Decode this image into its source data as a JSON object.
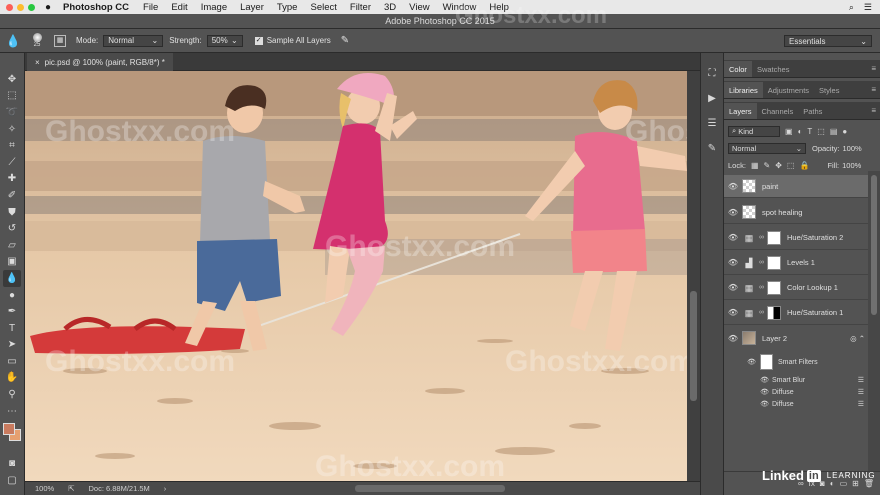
{
  "menubar": {
    "app_name": "Photoshop CC",
    "items": [
      "File",
      "Edit",
      "Image",
      "Layer",
      "Type",
      "Select",
      "Filter",
      "3D",
      "View",
      "Window",
      "Help"
    ]
  },
  "titlebar": {
    "title": "Adobe Photoshop CC 2015"
  },
  "options": {
    "brush_size": "25",
    "mode_label": "Mode:",
    "mode_value": "Normal",
    "strength_label": "Strength:",
    "strength_value": "50%",
    "sample_all_label": "Sample All Layers",
    "workspace": "Essentials"
  },
  "document": {
    "tab_title": "pic.psd @ 100% (paint, RGB/8*) *"
  },
  "status": {
    "zoom": "100%",
    "doc_size": "Doc: 6.88M/21.5M"
  },
  "panels": {
    "color_tabs": [
      "Color",
      "Swatches"
    ],
    "library_tabs": [
      "Libraries",
      "Adjustments",
      "Styles"
    ],
    "layer_tabs": [
      "Layers",
      "Channels",
      "Paths"
    ],
    "filter_kind": "Kind",
    "blend_mode": "Normal",
    "opacity_label": "Opacity:",
    "opacity_value": "100%",
    "lock_label": "Lock:",
    "fill_label": "Fill:",
    "fill_value": "100%"
  },
  "layers": [
    {
      "name": "paint"
    },
    {
      "name": "spot healing"
    },
    {
      "name": "Hue/Saturation 2"
    },
    {
      "name": "Levels 1"
    },
    {
      "name": "Color Lookup 1"
    },
    {
      "name": "Hue/Saturation 1"
    },
    {
      "name": "Layer 2"
    }
  ],
  "smart_filters": {
    "label": "Smart Filters",
    "items": [
      "Smart Blur",
      "Diffuse",
      "Diffuse"
    ]
  },
  "watermark": {
    "text": "Ghostxx.com"
  },
  "branding": {
    "linked": "Linked",
    "in": "in",
    "learning": "LEARNING"
  },
  "colors": {
    "foreground": "#c97b5f",
    "background": "#e6a070"
  }
}
